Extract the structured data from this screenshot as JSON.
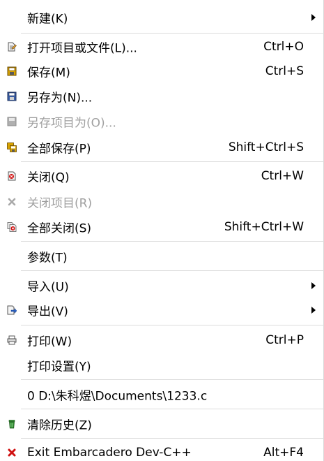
{
  "menu": {
    "new": {
      "label": "新建(K)"
    },
    "open": {
      "label": "打开项目或文件(L)...",
      "shortcut": "Ctrl+O"
    },
    "save": {
      "label": "保存(M)",
      "shortcut": "Ctrl+S"
    },
    "save_as": {
      "label": "另存为(N)..."
    },
    "save_project_as": {
      "label": "另存项目为(O)..."
    },
    "save_all": {
      "label": "全部保存(P)",
      "shortcut": "Shift+Ctrl+S"
    },
    "close": {
      "label": "关闭(Q)",
      "shortcut": "Ctrl+W"
    },
    "close_project": {
      "label": "关闭项目(R)"
    },
    "close_all": {
      "label": "全部关闭(S)",
      "shortcut": "Shift+Ctrl+W"
    },
    "parameters": {
      "label": "参数(T)"
    },
    "import": {
      "label": "导入(U)"
    },
    "export": {
      "label": "导出(V)"
    },
    "print": {
      "label": "打印(W)",
      "shortcut": "Ctrl+P"
    },
    "print_setup": {
      "label": "打印设置(Y)"
    },
    "recent_0": {
      "label": "0 D:\\朱科煜\\Documents\\1233.c"
    },
    "clear_history": {
      "label": "清除历史(Z)"
    },
    "exit": {
      "label": "Exit Embarcadero Dev-C++",
      "shortcut": "Alt+F4"
    }
  },
  "colors": {
    "disabled_text": "#a0a0a0",
    "separator": "#dcdcdc",
    "exit_icon": "#d01010",
    "clear_icon": "#2e8b2e"
  }
}
